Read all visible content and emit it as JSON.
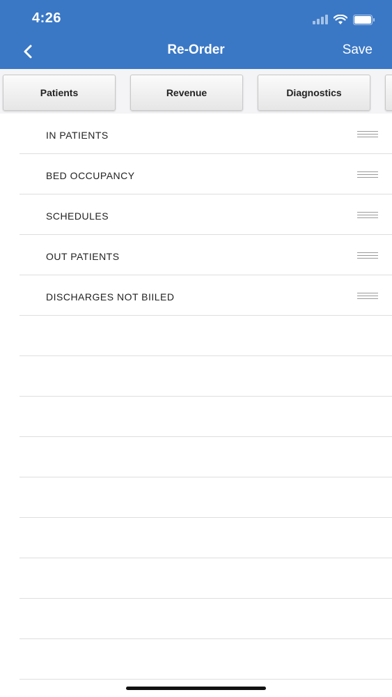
{
  "status_bar": {
    "time": "4:26",
    "icons": [
      "cellular-signal-icon",
      "wifi-icon",
      "battery-icon"
    ]
  },
  "nav": {
    "back_icon": "chevron-left-icon",
    "title": "Re-Order",
    "save_label": "Save"
  },
  "tabs": [
    {
      "label": "Patients"
    },
    {
      "label": "Revenue"
    },
    {
      "label": "Diagnostics"
    },
    {
      "label": ""
    }
  ],
  "list": {
    "items": [
      {
        "label": "IN PATIENTS"
      },
      {
        "label": "BED OCCUPANCY"
      },
      {
        "label": "SCHEDULES"
      },
      {
        "label": "OUT PATIENTS"
      },
      {
        "label": "DISCHARGES NOT BIILED"
      }
    ],
    "empty_rows": 9
  },
  "colors": {
    "header_blue": "#3a78c6",
    "separator": "#dedede"
  }
}
